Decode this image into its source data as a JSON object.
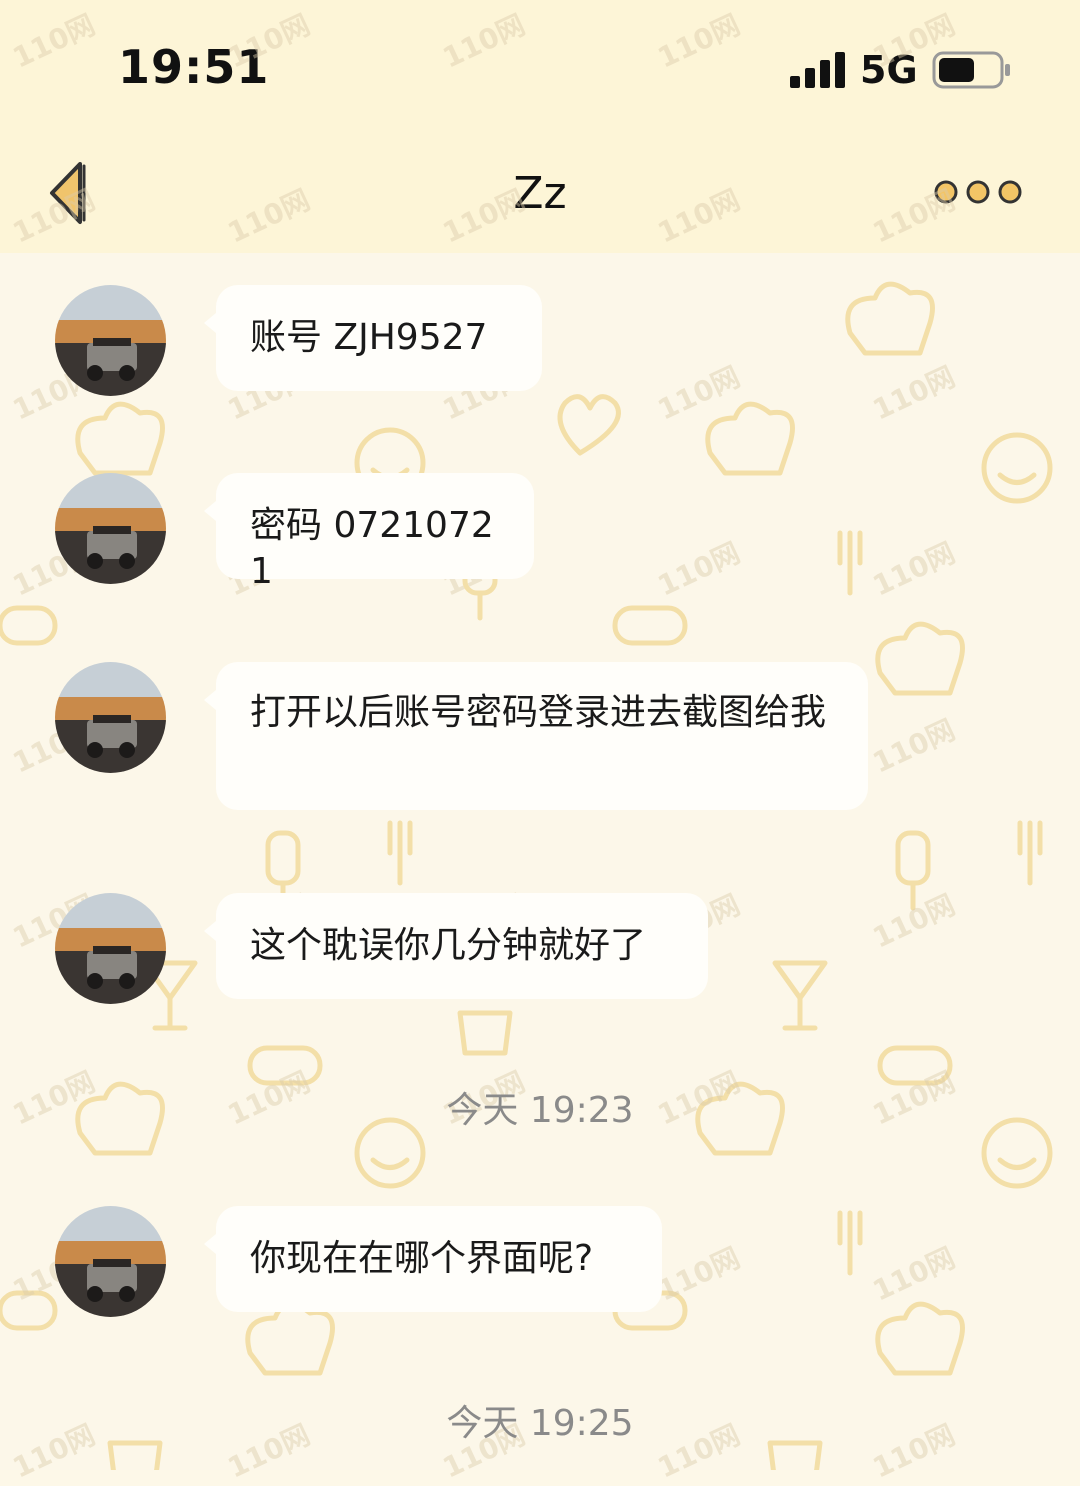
{
  "status_bar": {
    "time": "19:51",
    "network": "5G",
    "battery_level": 0.6
  },
  "nav": {
    "title": "Zz",
    "back_icon": "chevron-left-icon",
    "more_icon": "more-icon"
  },
  "messages": [
    {
      "type": "received",
      "text": "账号 ZJH9527"
    },
    {
      "type": "received",
      "text": "密码 07210721"
    },
    {
      "type": "received",
      "text": "打开以后账号密码登录进去截图给我"
    },
    {
      "type": "received",
      "text": "这个耽误你几分钟就好了"
    },
    {
      "type": "timestamp",
      "text": "今天 19:23"
    },
    {
      "type": "received",
      "text": "你现在在哪个界面呢?"
    },
    {
      "type": "timestamp",
      "text": "今天 19:25"
    }
  ],
  "watermark": "110网",
  "colors": {
    "header_bg": "#fdf5d7",
    "chat_bg": "#fcf7e9",
    "bubble_bg": "#fffefa",
    "doodle": "#f3dfa8",
    "back_icon": "#f0c46c"
  }
}
